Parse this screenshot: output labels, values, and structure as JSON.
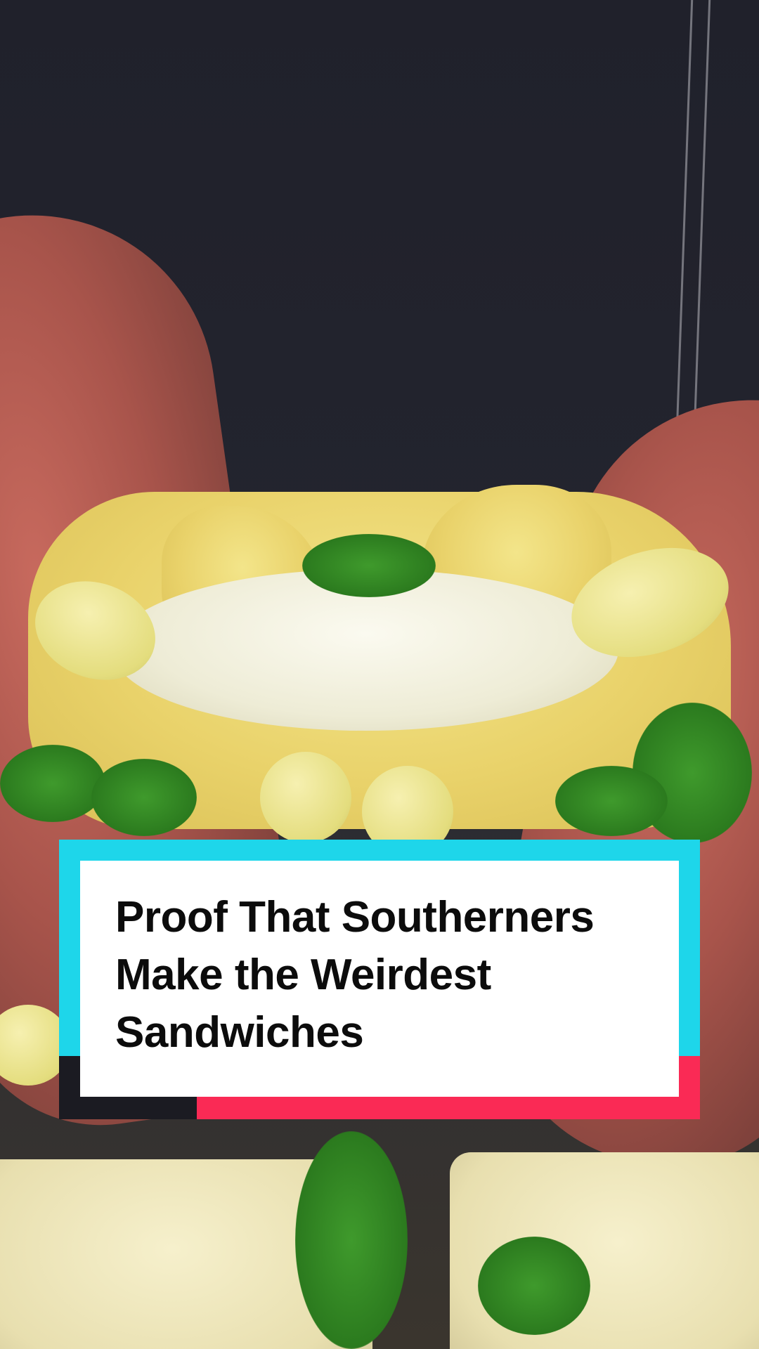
{
  "title_card": {
    "lines": [
      "Proof That Southerners",
      "Make the Weirdest",
      "Sandwiches"
    ],
    "colors": {
      "frame_cyan": "#1ed6ea",
      "frame_red": "#fa2a55",
      "frame_dark": "#1b1b22",
      "panel": "#ffffff",
      "text": "#0c0c0c"
    }
  },
  "background": {
    "subject": "hands pulling apart a dill-herb sandwich",
    "palette": {
      "shirt": "#20212b",
      "skin": "#a8544b",
      "nails": "#e4dd7e",
      "bread": "#e9d26a",
      "filling": "#eeecd6",
      "herbs": "#2b7a1e"
    }
  }
}
